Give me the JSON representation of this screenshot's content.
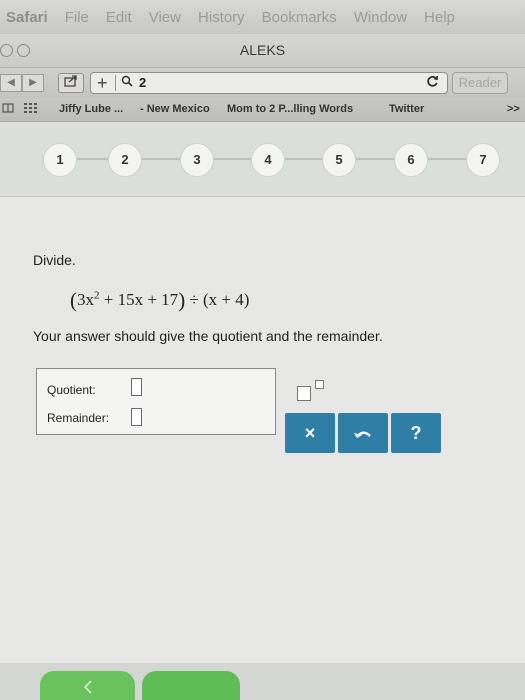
{
  "menubar": {
    "items": [
      "Safari",
      "File",
      "Edit",
      "View",
      "History",
      "Bookmarks",
      "Window",
      "Help"
    ]
  },
  "window": {
    "title": "ALEKS"
  },
  "toolbar": {
    "back_icon": "◀",
    "forward_icon": "▶",
    "share_icon": "share-icon",
    "url_plus": "+",
    "search_icon": "🔍",
    "url_text": "2",
    "reload_icon": "C",
    "reader_label": "Reader"
  },
  "bookmarks": {
    "items": [
      "Jiffy Lube ...",
      "- New Mexico",
      "Mom to 2 P...lling Words",
      "Twitter"
    ],
    "overflow": ">>"
  },
  "progress": {
    "steps": [
      "1",
      "2",
      "3",
      "4",
      "5",
      "6",
      "7"
    ]
  },
  "question": {
    "label": "Divide.",
    "expression": {
      "open": "(",
      "term1_coef": "3x",
      "term1_exp": "2",
      "rest": " + 15x + 17",
      "close": ")",
      "divide": " ÷ (x + 4)"
    },
    "instructions": "Your answer should give the quotient and the remainder."
  },
  "answer": {
    "quotient_label": "Quotient:",
    "remainder_label": "Remainder:",
    "quotient_value": "",
    "remainder_value": ""
  },
  "tools": {
    "clear": "×",
    "undo": "↶",
    "help": "?"
  },
  "colors": {
    "tool_button": "#2e7ea6",
    "nav_green": "#5fbd55"
  }
}
